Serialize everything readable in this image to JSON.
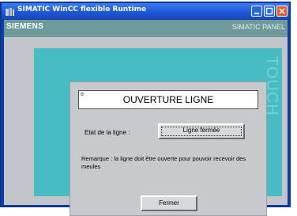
{
  "window": {
    "title": "SIMATIC WinCC flexible Runtime",
    "controls": [
      "minimize-icon",
      "maximize-icon",
      "close-icon"
    ]
  },
  "header": {
    "brand": "SIEMENS",
    "panel": "SIMATIC PANEL",
    "side_label": "TOUCH"
  },
  "dialog": {
    "id": "0",
    "title": "OUVERTURE LIGNE",
    "state_label": "Etat de la ligne :",
    "state_button": "Ligne fermée",
    "remark": "Remarque : la ligne doit être ouverte pour pouvoir recevoir des meules",
    "close_button": "Fermer"
  },
  "colors": {
    "titlebar": "#1d56d8",
    "frame": "#47bcc4",
    "header_strip": "#6f9a9b",
    "close_button": "#e45a2a"
  }
}
